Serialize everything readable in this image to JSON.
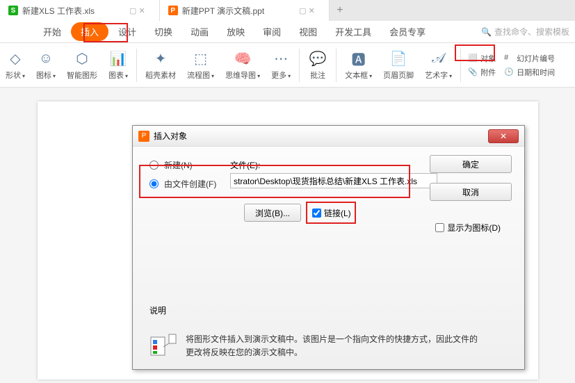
{
  "tabs": [
    {
      "icon": "S",
      "label": "新建XLS 工作表.xls"
    },
    {
      "icon": "P",
      "label": "新建PPT 演示文稿.ppt"
    }
  ],
  "menu": {
    "items": [
      "开始",
      "插入",
      "设计",
      "切换",
      "动画",
      "放映",
      "审阅",
      "视图",
      "开发工具",
      "会员专享"
    ],
    "active_index": 1,
    "search_placeholder": "查找命令、搜索模板"
  },
  "ribbon": {
    "groups": [
      {
        "label": "形状",
        "has_dropdown": true
      },
      {
        "label": "图标",
        "has_dropdown": true
      },
      {
        "label": "智能图形",
        "has_dropdown": false
      },
      {
        "label": "图表",
        "has_dropdown": true
      },
      {
        "label": "稻壳素材",
        "has_dropdown": false
      },
      {
        "label": "流程图",
        "has_dropdown": true
      },
      {
        "label": "思维导图",
        "has_dropdown": true
      },
      {
        "label": "更多",
        "has_dropdown": true
      },
      {
        "label": "批注",
        "has_dropdown": false
      },
      {
        "label": "文本框",
        "has_dropdown": true
      },
      {
        "label": "页眉页脚",
        "has_dropdown": false
      },
      {
        "label": "艺术字",
        "has_dropdown": true
      }
    ],
    "side": {
      "object": "对象",
      "attachment": "附件",
      "slide_num": "幻灯片编号",
      "datetime": "日期和时间"
    }
  },
  "dialog": {
    "title": "插入对象",
    "radio_new": "新建(N)",
    "radio_from_file": "由文件创建(F)",
    "file_label": "文件(E):",
    "file_value": "strator\\Desktop\\现货指标总结\\新建XLS 工作表.xls",
    "browse": "浏览(B)...",
    "link": "链接(L)",
    "ok": "确定",
    "cancel": "取消",
    "show_as_icon": "显示为图标(D)",
    "desc_label": "说明",
    "desc_text": "将图形文件插入到演示文稿中。该图片是一个指向文件的快捷方式，因此文件的更改将反映在您的演示文稿中。"
  }
}
